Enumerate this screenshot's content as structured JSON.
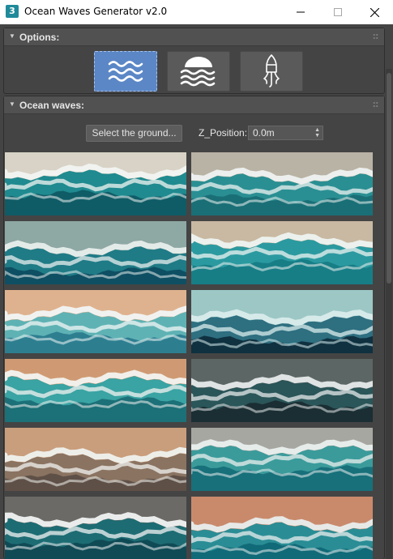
{
  "window": {
    "app_icon_glyph": "3",
    "title": "Ocean Waves Generator v2.0"
  },
  "options_rollout": {
    "title": "Options:",
    "buttons": [
      {
        "icon": "waves-icon",
        "active": true
      },
      {
        "icon": "sun-waves-icon",
        "active": false
      },
      {
        "icon": "buoy-icon",
        "active": false
      }
    ]
  },
  "ocean_rollout": {
    "title": "Ocean waves:",
    "select_ground_label": "Select the ground...",
    "z_position_label": "Z_Position:",
    "z_position_value": "0.0m"
  },
  "thumbnails": [
    {
      "name": "wave-thumb-1",
      "sand": "#d8d3c6",
      "foam": "#f2f4f2",
      "water": "#1f8a8f",
      "deep": "#0f5c66"
    },
    {
      "name": "wave-thumb-2",
      "sand": "#b9b3a5",
      "foam": "#eef2f0",
      "water": "#2a8f93",
      "deep": "#1a6f76"
    },
    {
      "name": "wave-thumb-3",
      "sand": "#8ea8a4",
      "foam": "#e8eeec",
      "water": "#1f7b86",
      "deep": "#0e4f63"
    },
    {
      "name": "wave-thumb-4",
      "sand": "#c9b9a2",
      "foam": "#eef3f1",
      "water": "#2b9aa0",
      "deep": "#177e86"
    },
    {
      "name": "wave-thumb-5",
      "sand": "#dfb28f",
      "foam": "#f1f5f5",
      "water": "#5fb2b4",
      "deep": "#2d7f90"
    },
    {
      "name": "wave-thumb-6",
      "sand": "#9cc7c5",
      "foam": "#d9ecec",
      "water": "#2e6f80",
      "deep": "#0f3140"
    },
    {
      "name": "wave-thumb-7",
      "sand": "#cf9a73",
      "foam": "#f3f3f0",
      "water": "#3aa3a3",
      "deep": "#1c7077"
    },
    {
      "name": "wave-thumb-8",
      "sand": "#5c6664",
      "foam": "#e6eaea",
      "water": "#2a5559",
      "deep": "#1a2e33"
    },
    {
      "name": "wave-thumb-9",
      "sand": "#c99e7c",
      "foam": "#f0f2ef",
      "water": "#8a7361",
      "deep": "#5f5047"
    },
    {
      "name": "wave-thumb-10",
      "sand": "#a7a7a1",
      "foam": "#e9efee",
      "water": "#3b9b9b",
      "deep": "#17707a"
    },
    {
      "name": "wave-thumb-11",
      "sand": "#6b6a66",
      "foam": "#f1f3f3",
      "water": "#1d6c73",
      "deep": "#0f4a55"
    },
    {
      "name": "wave-thumb-12",
      "sand": "#c98a6c",
      "foam": "#e9eeee",
      "water": "#2a8d95",
      "deep": "#116a78"
    }
  ],
  "colors": {
    "accent_active": "#5b87c6",
    "panel": "#444444",
    "header": "#515151"
  }
}
